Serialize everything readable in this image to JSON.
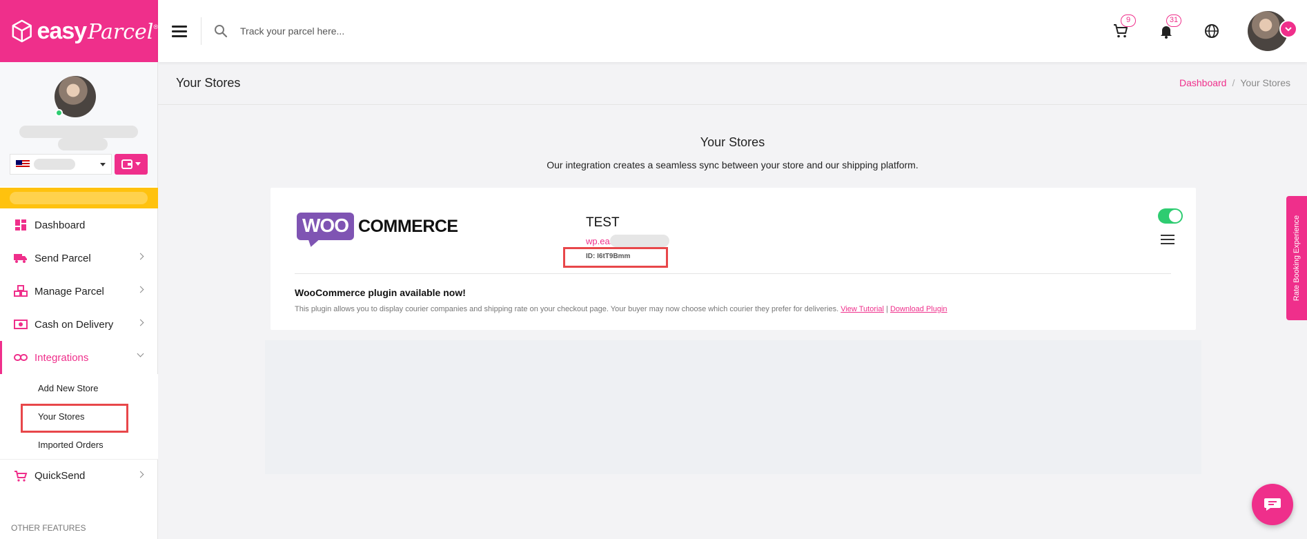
{
  "brand": {
    "name_bold": "easy",
    "name_script": "Parcel",
    "reg_mark": "®"
  },
  "topbar": {
    "search_placeholder": "Track your parcel here...",
    "cart_count": "9",
    "notification_count": "31"
  },
  "sidebar": {
    "items": [
      {
        "label": "Dashboard",
        "icon": "dashboard-icon"
      },
      {
        "label": "Send Parcel",
        "icon": "truck-icon"
      },
      {
        "label": "Manage Parcel",
        "icon": "boxes-icon"
      },
      {
        "label": "Cash on Delivery",
        "icon": "cash-icon"
      },
      {
        "label": "Integrations",
        "icon": "link-icon"
      }
    ],
    "integrations_sub": [
      "Add New Store",
      "Your Stores",
      "Imported Orders"
    ],
    "quicksend": {
      "label": "QuickSend",
      "icon": "cart-icon"
    },
    "section_label": "OTHER FEATURES"
  },
  "page": {
    "title": "Your Stores",
    "breadcrumb": {
      "home": "Dashboard",
      "sep": "/",
      "current": "Your Stores"
    },
    "heading": "Your Stores",
    "subheading": "Our integration creates a seamless sync between your store and our shipping platform."
  },
  "store": {
    "platform_logo_part1": "WOO",
    "platform_logo_part2": "COMMERCE",
    "name": "TEST",
    "url_visible": "wp.eas",
    "id": "ID: I6tT9Bmm",
    "enabled": true,
    "plugin_title": "WooCommerce plugin available now!",
    "plugin_desc": "This plugin allows you to display courier companies and shipping rate on your checkout page. Your buyer may now choose which courier they prefer for deliveries.",
    "link_tutorial": "View Tutorial",
    "link_sep": "|",
    "link_download": "Download Plugin"
  },
  "floating": {
    "rate_tab": "Rate Booking Experience"
  },
  "colors": {
    "brand": "#ef2f8b",
    "toggle_on": "#2ecc71",
    "highlight": "#e8474a",
    "yellow": "#ffc20e"
  }
}
